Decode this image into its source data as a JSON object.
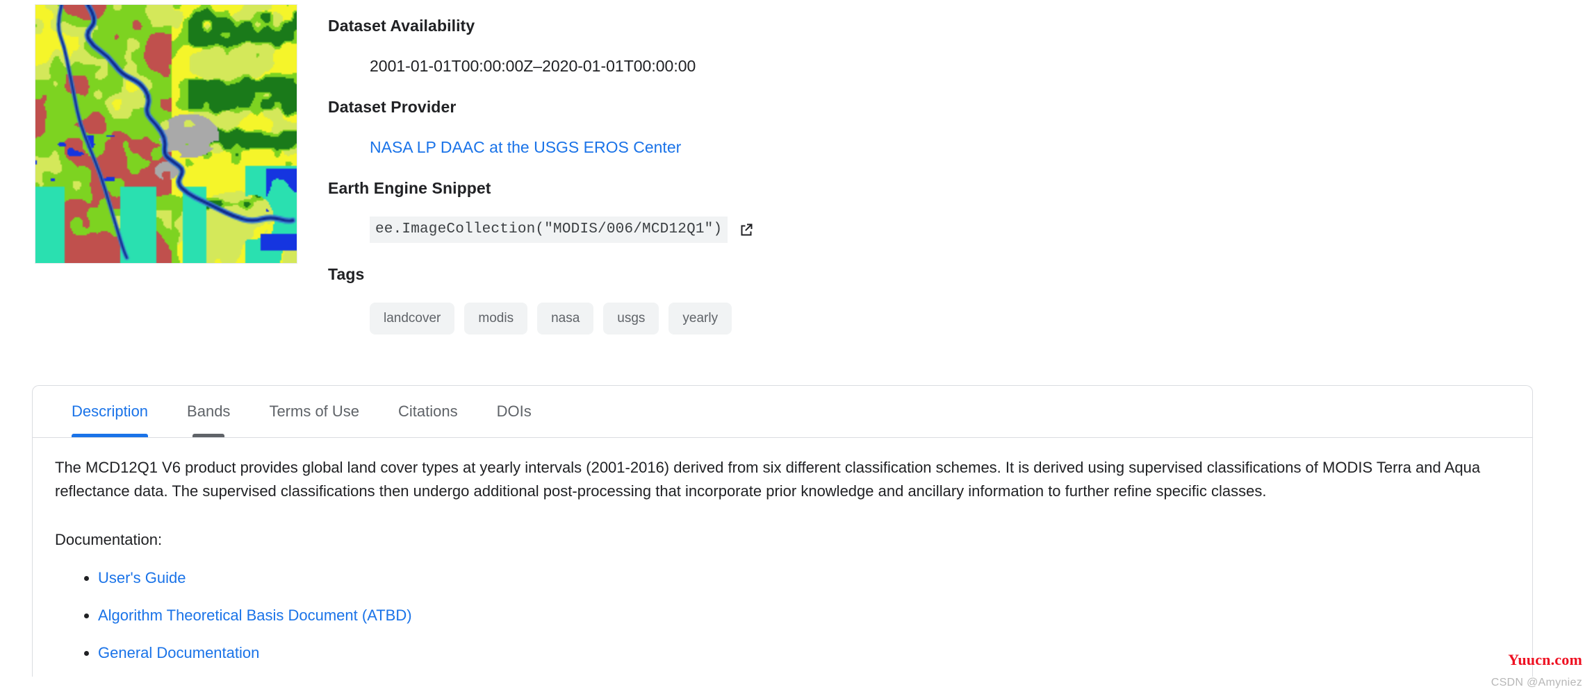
{
  "thumbnail": {
    "alt": "MODIS MCD12Q1 land cover classification map thumbnail",
    "palette": [
      "#1a7a1a",
      "#7dd321",
      "#f5f52a",
      "#c0504d",
      "#a9a9a9",
      "#2ae0b0",
      "#1535e0",
      "#d4e85a"
    ]
  },
  "fields": {
    "availability_label": "Dataset Availability",
    "availability_value": "2001-01-01T00:00:00Z–2020-01-01T00:00:00",
    "provider_label": "Dataset Provider",
    "provider_value": "NASA LP DAAC at the USGS EROS Center",
    "snippet_label": "Earth Engine Snippet",
    "snippet_value": "ee.ImageCollection(\"MODIS/006/MCD12Q1\")",
    "tags_label": "Tags"
  },
  "tags": [
    "landcover",
    "modis",
    "nasa",
    "usgs",
    "yearly"
  ],
  "tabs": [
    {
      "label": "Description",
      "state": "active"
    },
    {
      "label": "Bands",
      "state": "hovered"
    },
    {
      "label": "Terms of Use",
      "state": "normal"
    },
    {
      "label": "Citations",
      "state": "normal"
    },
    {
      "label": "DOIs",
      "state": "normal"
    }
  ],
  "description": {
    "paragraph": "The MCD12Q1 V6 product provides global land cover types at yearly intervals (2001-2016) derived from six different classification schemes. It is derived using supervised classifications of MODIS Terra and Aqua reflectance data. The supervised classifications then undergo additional post-processing that incorporate prior knowledge and ancillary information to further refine specific classes.",
    "documentation_label": "Documentation:",
    "documentation_links": [
      "User's Guide",
      "Algorithm Theoretical Basis Document (ATBD)",
      "General Documentation"
    ]
  },
  "watermarks": {
    "primary": "Yuucn.com",
    "secondary": "CSDN @Amyniez"
  },
  "colors": {
    "link": "#1a73e8",
    "accent": "#1a73e8",
    "chip_bg": "#f1f3f4",
    "border": "#dadce0",
    "watermark_red": "#ee1122"
  }
}
